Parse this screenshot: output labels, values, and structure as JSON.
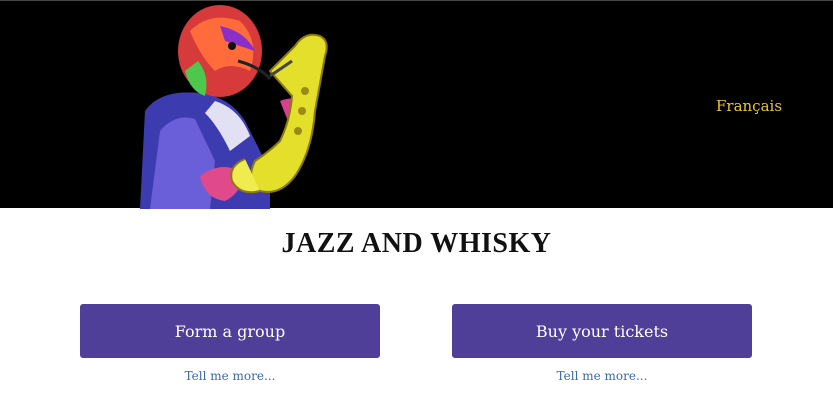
{
  "header": {
    "language_link": "Français"
  },
  "main": {
    "title": "JAZZ AND WHISKY",
    "actions": [
      {
        "label": "Form a group",
        "more": "Tell me more..."
      },
      {
        "label": "Buy your tickets",
        "more": "Tell me more..."
      }
    ]
  },
  "colors": {
    "banner_bg": "#000000",
    "accent_button": "#4f3f98",
    "language_link": "#e8c53a",
    "more_link": "#3a6aa8"
  },
  "icons": [
    "saxophone-player-illustration"
  ]
}
